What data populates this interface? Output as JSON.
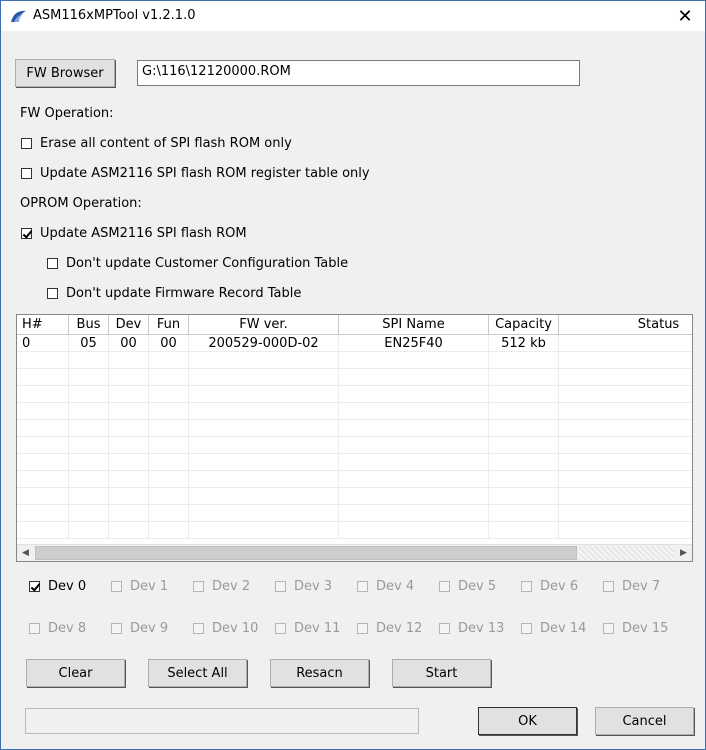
{
  "window": {
    "title": "ASM116xMPTool v1.2.1.0"
  },
  "fw": {
    "browse_label": "FW Browser",
    "path_value": "G:\\116\\12120000.ROM",
    "operation_label": "FW Operation:",
    "erase_label": "Erase all content of SPI flash ROM only",
    "erase_checked": false,
    "update_reg_label": "Update ASM2116 SPI flash ROM register table only",
    "update_reg_checked": false
  },
  "oprom": {
    "operation_label": "OPROM Operation:",
    "update_label": "Update ASM2116 SPI flash ROM",
    "update_checked": true,
    "no_cct_label": "Don't update Customer Configuration Table",
    "no_cct_checked": false,
    "no_frt_label": "Don't update Firmware Record Table",
    "no_frt_checked": false
  },
  "table": {
    "columns": [
      "H#",
      "Bus",
      "Dev",
      "Fun",
      "FW ver.",
      "SPI Name",
      "Capacity",
      "Status"
    ],
    "rows": [
      [
        "0",
        "05",
        "00",
        "00",
        "200529-000D-02",
        "EN25F40",
        "512 kb",
        ""
      ]
    ]
  },
  "devices": {
    "row1": [
      {
        "label": "Dev 0",
        "checked": true,
        "enabled": true
      },
      {
        "label": "Dev 1",
        "checked": false,
        "enabled": false
      },
      {
        "label": "Dev 2",
        "checked": false,
        "enabled": false
      },
      {
        "label": "Dev 3",
        "checked": false,
        "enabled": false
      },
      {
        "label": "Dev 4",
        "checked": false,
        "enabled": false
      },
      {
        "label": "Dev 5",
        "checked": false,
        "enabled": false
      },
      {
        "label": "Dev 6",
        "checked": false,
        "enabled": false
      },
      {
        "label": "Dev 7",
        "checked": false,
        "enabled": false
      }
    ],
    "row2": [
      {
        "label": "Dev 8",
        "checked": false,
        "enabled": false
      },
      {
        "label": "Dev 9",
        "checked": false,
        "enabled": false
      },
      {
        "label": "Dev 10",
        "checked": false,
        "enabled": false
      },
      {
        "label": "Dev 11",
        "checked": false,
        "enabled": false
      },
      {
        "label": "Dev 12",
        "checked": false,
        "enabled": false
      },
      {
        "label": "Dev 13",
        "checked": false,
        "enabled": false
      },
      {
        "label": "Dev 14",
        "checked": false,
        "enabled": false
      },
      {
        "label": "Dev 15",
        "checked": false,
        "enabled": false
      }
    ]
  },
  "actions": {
    "clear": "Clear",
    "select_all": "Select All",
    "rescan": "Resacn",
    "start": "Start",
    "ok": "OK",
    "cancel": "Cancel"
  }
}
